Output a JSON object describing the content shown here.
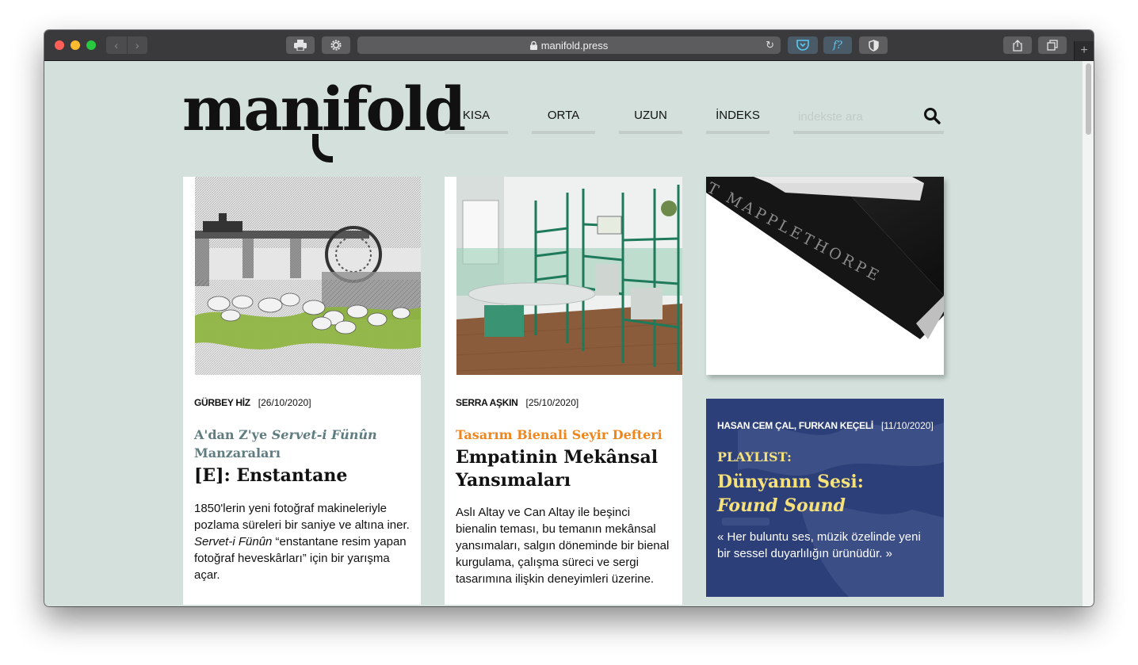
{
  "browser": {
    "url": "manifold.press",
    "colors": {
      "close": "#ff5f57",
      "minimize": "#febc2e",
      "zoom": "#28c840"
    },
    "icons": [
      "print-icon",
      "gear-icon",
      "lock-icon",
      "reload-icon",
      "pocket-icon",
      "font-icon",
      "shield-icon",
      "share-icon",
      "tabs-icon",
      "plus-icon"
    ],
    "font_button": "f?"
  },
  "site": {
    "logo": "manifold",
    "nav": [
      "KISA",
      "ORTA",
      "UZUN",
      "İNDEKS"
    ],
    "search_placeholder": "indekste ara",
    "bg_color": "#d3e0dc"
  },
  "cards": [
    {
      "author": "GÜRBEY HİZ",
      "date": "[26/10/2020]",
      "kicker_a": "A'dan Z'ye ",
      "kicker_b": "Servet-i Fünûn",
      "kicker_c": " Manzaraları",
      "kicker_color": "#5f7d80",
      "title": "[E]: Enstantane",
      "excerpt_a": "1850'lerin yeni fotoğraf makineleriyle pozlama süreleri bir saniye ve altına iner. ",
      "excerpt_b": "Servet-i Fünûn",
      "excerpt_c": " “enstantane resim yapan fotoğraf heveskârları” için bir yarışma açar."
    },
    {
      "author": "SERRA AŞKIN",
      "date": "[25/10/2020]",
      "kicker": "Tasarım Bienali Seyir Defteri",
      "kicker_color": "#f0851a",
      "title": "Empatinin Mekânsal Yansımaları",
      "excerpt": "Aslı Altay ve Can Altay ile beşinci bienalin teması, bu temanın mekânsal yansımaları, salgın döneminde bir bienal kurgulama, çalışma süreci ve sergi tasarımına ilişkin deneyimleri üzerine."
    }
  ],
  "book": {
    "spine_text": "T MAPPLETHORPE"
  },
  "playlist": {
    "authors": "HASAN CEM ÇAL, FURKAN KEÇELİ",
    "date": "[11/10/2020]",
    "label": "PLAYLIST:",
    "title_line1": "Dünyanın Sesi:",
    "title_line2": "Found Sound",
    "quote": "« Her buluntu ses, müzik özelinde yeni bir sessel duyarlılığın ürünüdür. »",
    "accent": "#f6e17a",
    "bg": "#2c3f78"
  }
}
